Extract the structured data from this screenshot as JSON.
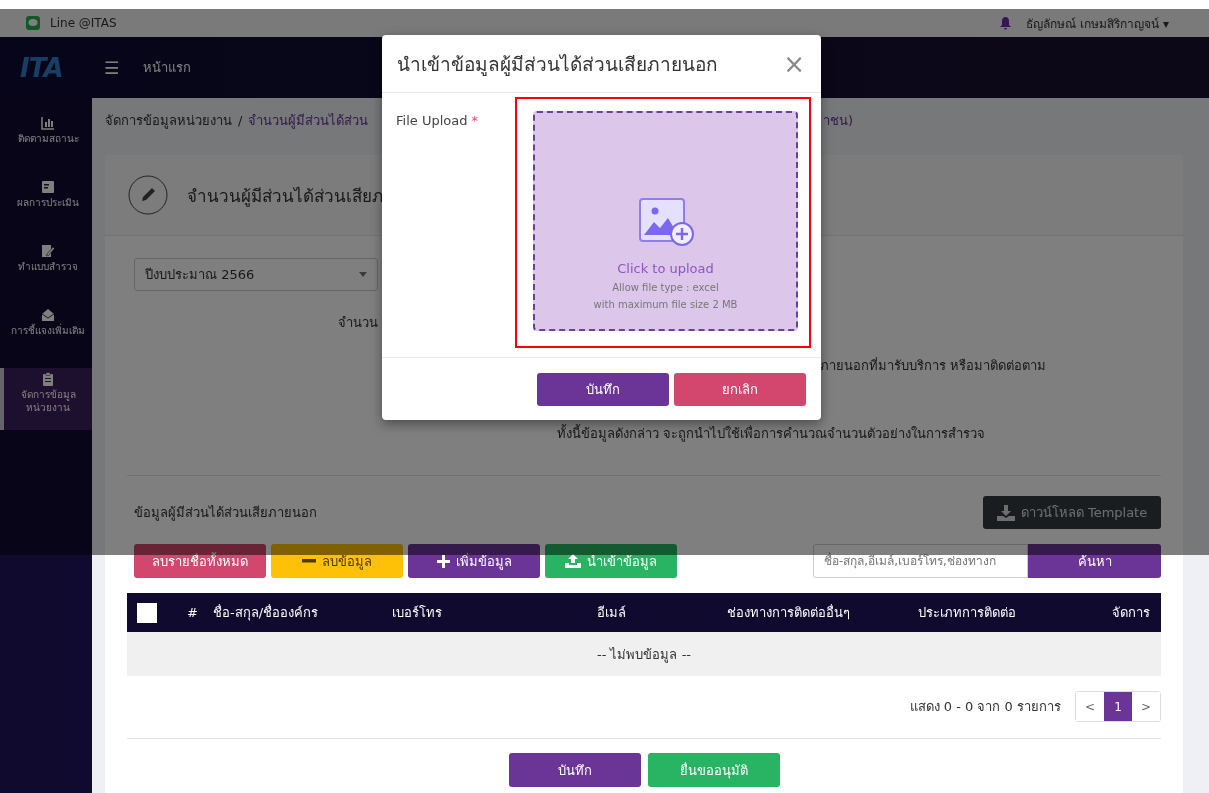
{
  "top_bar": {
    "app_label": "Line @ITAS",
    "user_name": "ธัญลักษณ์ เกษมสิริกาญจน์",
    "user_caret": "▾"
  },
  "nav_bar": {
    "logo": "ITA",
    "menu_glyph": "☰",
    "home_link": "หน้าแรก"
  },
  "sidebar": {
    "items": [
      {
        "label": "ติดตามสถานะ",
        "selected": false
      },
      {
        "label": "ผลการประเมิน",
        "selected": false
      },
      {
        "label": "ทำแบบสำรวจ",
        "selected": false
      },
      {
        "label": "การชี้แจงเพิ่มเติม",
        "selected": false
      },
      {
        "label": "จัดการข้อมูล หน่วยงาน",
        "selected": true
      }
    ]
  },
  "breadcrumb": {
    "first": "จัดการข้อมูลหน่วยงาน",
    "separator": "/",
    "current_visible": "จำนวนผู้มีส่วนได้ส่วน",
    "current_tail": "าชน)"
  },
  "card": {
    "title": "จำนวนผู้มีส่วนได้ส่วนเสียภ",
    "year_select": "ปีงบประมาณ 2566",
    "note_lines": [
      "จำนวน",
      "ภายนอกที่มารับบริการ หรือมาติดต่อตาม",
      "ทั้งนี้ข้อมูลดังกล่าว จะถูกนำไปใช้เพื่อการคำนวณจำนวนตัวอย่างในการสำรวจ"
    ],
    "section_title": "ข้อมูลผู้มีส่วนได้ส่วนเสียภายนอก",
    "download_button": "ดาวน์โหลด Template",
    "actions": [
      {
        "label": "ลบรายชื่อทั้งหมด",
        "kind": "delete-all"
      },
      {
        "label": "ลบข้อมูล",
        "kind": "remove"
      },
      {
        "label": "เพิ่มข้อมูล",
        "kind": "add"
      },
      {
        "label": "นำเข้าข้อมูล",
        "kind": "import"
      }
    ],
    "search": {
      "placeholder": "ชื่อ-สกุล,อีเมล์,เบอร์โทร,ช่องทางก",
      "button": "ค้นหา"
    },
    "table": {
      "select_all_checked": false,
      "columns": [
        "#",
        "ชื่อ-สกุล/ชื่อองค์กร",
        "เบอร์โทร",
        "อีเมล์",
        "ช่องทางการติดต่ออื่นๆ",
        "ประเภทการติดต่อ",
        "จัดการ"
      ],
      "empty_message": "-- ไม่พบข้อมูล --"
    },
    "pagination": {
      "summary": "แสดง 0 - 0 จาก 0 รายการ",
      "prev": "<",
      "pages": [
        {
          "label": "1",
          "selected": true
        }
      ],
      "next": ">"
    },
    "footer_buttons": [
      {
        "label": "บันทึก",
        "kind": "save"
      },
      {
        "label": "ยื่นขออนุมัติ",
        "kind": "submit"
      }
    ]
  },
  "modal": {
    "title": "นำเข้าข้อมูลผู้มีส่วนได้ส่วนเสียภายนอก",
    "close_glyph": "×",
    "field_label": "File Upload",
    "required_mark": "*",
    "upload": {
      "prompt": "Click to upload",
      "hint_type": "Allow file type : excel",
      "hint_size": "with maximum file size 2 MB",
      "highlighted": true
    },
    "buttons": [
      {
        "label": "บันทึก",
        "kind": "save"
      },
      {
        "label": "ยกเลิก",
        "kind": "cancel"
      }
    ]
  }
}
